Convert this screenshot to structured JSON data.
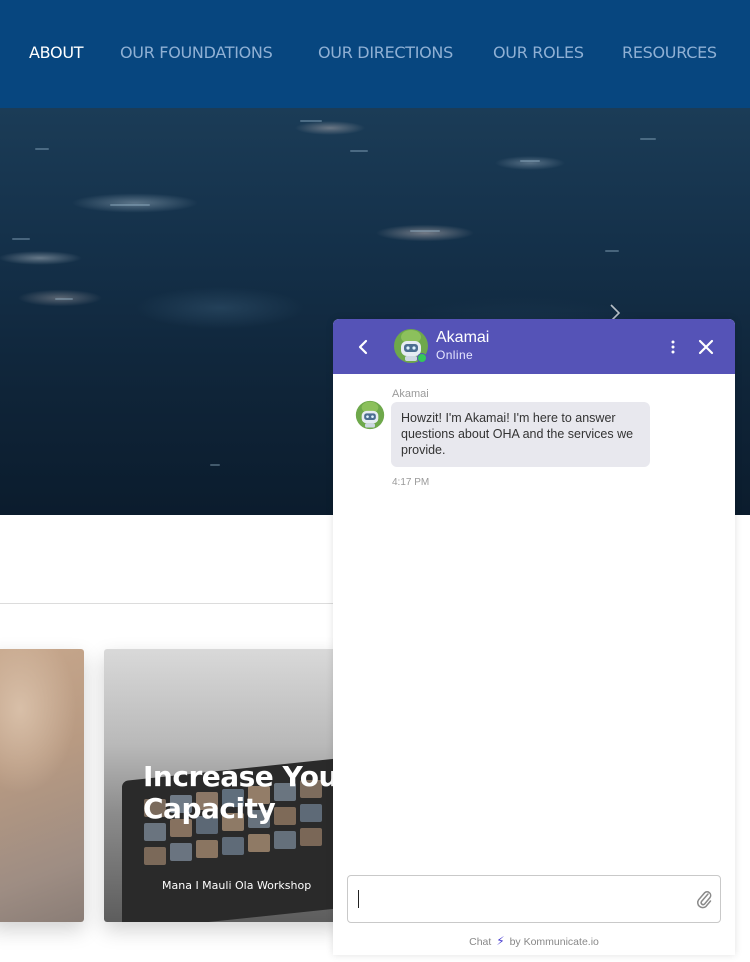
{
  "nav": {
    "items": [
      {
        "label": "ABOUT",
        "active": true
      },
      {
        "label": "OUR FOUNDATIONS",
        "active": false
      },
      {
        "label": "OUR DIRECTIONS",
        "active": false
      },
      {
        "label": "OUR ROLES",
        "active": false
      },
      {
        "label": "RESOURCES",
        "active": false
      }
    ],
    "background": "#07467f"
  },
  "hero": {
    "next_icon": "chevron-right-icon"
  },
  "cards": [
    {
      "title": "",
      "subtitle": ""
    },
    {
      "title": "Increase Your Capacity",
      "subtitle": "Mana I Mauli Ola Workshop"
    }
  ],
  "chat": {
    "header_color": "#5553b7",
    "bot_name": "Akamai",
    "status": "Online",
    "icons": {
      "back": "chevron-left-icon",
      "menu": "more-vertical-icon",
      "close": "close-icon",
      "attach": "paperclip-icon",
      "powered": "lightning-icon"
    },
    "messages": [
      {
        "sender": "Akamai",
        "text": "Howzit! I'm Akamai! I'm here to answer questions about OHA and the services we provide.",
        "time": "4:17 PM"
      }
    ],
    "input": {
      "value": "",
      "placeholder": ""
    },
    "powered_prefix": "Chat",
    "powered_suffix": "by Kommunicate.io"
  }
}
